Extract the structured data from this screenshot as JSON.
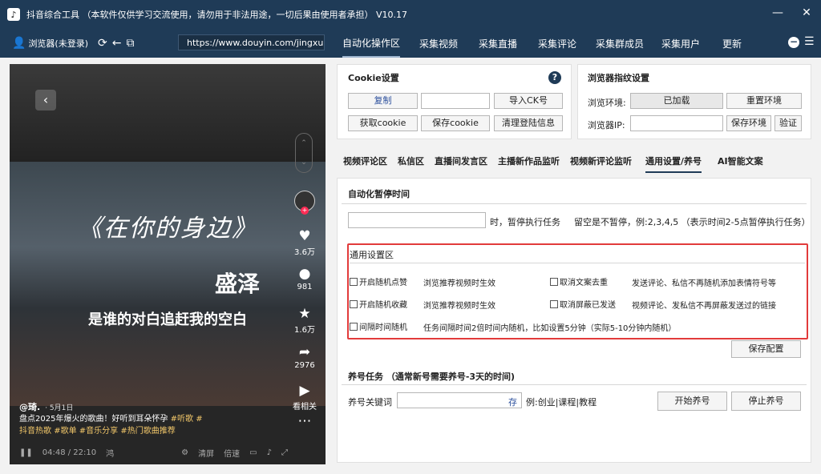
{
  "window": {
    "title": "抖音综合工具 （本软件仅供学习交流使用，请勿用于非法用途，一切后果由使用者承担） V10.17",
    "controls": {
      "minimize": "—",
      "close": "✕"
    }
  },
  "nav": {
    "browser_label": "浏览器(未登录)",
    "url": "https://www.douyin.com/jingxuan",
    "tabs": [
      "自动化操作区",
      "采集视频",
      "采集直播",
      "采集评论",
      "采集群成员",
      "采集用户",
      "更新"
    ],
    "active_tab": "自动化操作区"
  },
  "video": {
    "song_title": "《在你的身边》",
    "singer": "盛泽",
    "lyric": "是谁的对白追赶我的空白",
    "likes": "3.6万",
    "comments": "981",
    "favorites": "1.6万",
    "shares": "2976",
    "related_label": "看相关",
    "author": "@琦.",
    "date": "· 5月1日",
    "desc_text": "盘点2025年爆火的歌曲！好听到耳朵怀孕",
    "desc_tags": [
      "#听歌",
      "#",
      "抖音热歌",
      "#歌单",
      "#音乐分享",
      "#热门歌曲推荐"
    ],
    "time": "04:48 / 22:10",
    "player_labels": [
      "鸿",
      "清屏",
      "倍速"
    ]
  },
  "cookie": {
    "title": "Cookie设置",
    "copy": "复制",
    "import": "导入CK号",
    "get": "获取cookie",
    "save": "保存cookie",
    "clear": "清理登陆信息"
  },
  "fingerprint": {
    "title": "浏览器指纹设置",
    "env_label": "浏览环境:",
    "env_status": "已加载",
    "reset": "重置环境",
    "ip_label": "浏览器IP:",
    "save_env": "保存环境",
    "verify": "验证"
  },
  "subtabs": [
    "视频评论区",
    "私信区",
    "直播间发言区",
    "主播新作品监听",
    "视频新评论监听",
    "通用设置/养号",
    "AI智能文案"
  ],
  "pause": {
    "title": "自动化暂停时间",
    "unit": "时，暂停执行任务",
    "hint": "留空是不暂停，例:2,3,4,5 （表示时间2-5点暂停执行任务）"
  },
  "general": {
    "title": "通用设置区",
    "items": [
      {
        "label": "开启随机点赞",
        "desc": "浏览推荐视频时生效"
      },
      {
        "label": "取消文案去重",
        "desc": "发送评论、私信不再随机添加表情符号等"
      },
      {
        "label": "开启随机收藏",
        "desc": "浏览推荐视频时生效"
      },
      {
        "label": "取消屏蔽已发送",
        "desc": "视频评论、发私信不再屏蔽发送过的链接"
      },
      {
        "label": "间隔时间随机",
        "desc": "任务间隔时间2倍时间内随机，比如设置5分钟（实际5-10分钟内随机）"
      }
    ],
    "save": "保存配置"
  },
  "nurture": {
    "title": "养号任务 （通常新号需要养号-3天的时间)",
    "keyword_label": "养号关键词",
    "keyword_btn": "存",
    "example": "例:创业|课程|教程",
    "start": "开始养号",
    "stop": "停止养号"
  }
}
